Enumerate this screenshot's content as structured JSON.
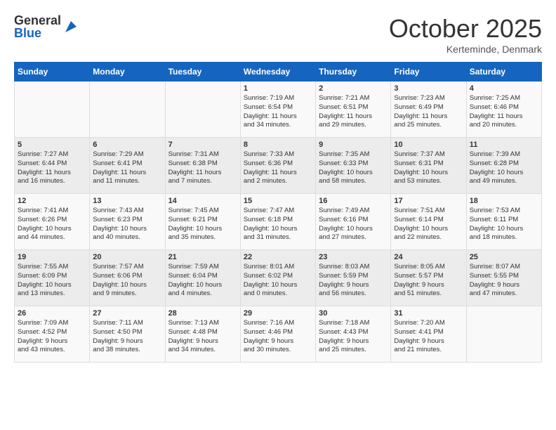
{
  "header": {
    "logo_general": "General",
    "logo_blue": "Blue",
    "month": "October 2025",
    "location": "Kerteminde, Denmark"
  },
  "days_of_week": [
    "Sunday",
    "Monday",
    "Tuesday",
    "Wednesday",
    "Thursday",
    "Friday",
    "Saturday"
  ],
  "weeks": [
    [
      {
        "day": "",
        "info": ""
      },
      {
        "day": "",
        "info": ""
      },
      {
        "day": "",
        "info": ""
      },
      {
        "day": "1",
        "info": "Sunrise: 7:19 AM\nSunset: 6:54 PM\nDaylight: 11 hours\nand 34 minutes."
      },
      {
        "day": "2",
        "info": "Sunrise: 7:21 AM\nSunset: 6:51 PM\nDaylight: 11 hours\nand 29 minutes."
      },
      {
        "day": "3",
        "info": "Sunrise: 7:23 AM\nSunset: 6:49 PM\nDaylight: 11 hours\nand 25 minutes."
      },
      {
        "day": "4",
        "info": "Sunrise: 7:25 AM\nSunset: 6:46 PM\nDaylight: 11 hours\nand 20 minutes."
      }
    ],
    [
      {
        "day": "5",
        "info": "Sunrise: 7:27 AM\nSunset: 6:44 PM\nDaylight: 11 hours\nand 16 minutes."
      },
      {
        "day": "6",
        "info": "Sunrise: 7:29 AM\nSunset: 6:41 PM\nDaylight: 11 hours\nand 11 minutes."
      },
      {
        "day": "7",
        "info": "Sunrise: 7:31 AM\nSunset: 6:38 PM\nDaylight: 11 hours\nand 7 minutes."
      },
      {
        "day": "8",
        "info": "Sunrise: 7:33 AM\nSunset: 6:36 PM\nDaylight: 11 hours\nand 2 minutes."
      },
      {
        "day": "9",
        "info": "Sunrise: 7:35 AM\nSunset: 6:33 PM\nDaylight: 10 hours\nand 58 minutes."
      },
      {
        "day": "10",
        "info": "Sunrise: 7:37 AM\nSunset: 6:31 PM\nDaylight: 10 hours\nand 53 minutes."
      },
      {
        "day": "11",
        "info": "Sunrise: 7:39 AM\nSunset: 6:28 PM\nDaylight: 10 hours\nand 49 minutes."
      }
    ],
    [
      {
        "day": "12",
        "info": "Sunrise: 7:41 AM\nSunset: 6:26 PM\nDaylight: 10 hours\nand 44 minutes."
      },
      {
        "day": "13",
        "info": "Sunrise: 7:43 AM\nSunset: 6:23 PM\nDaylight: 10 hours\nand 40 minutes."
      },
      {
        "day": "14",
        "info": "Sunrise: 7:45 AM\nSunset: 6:21 PM\nDaylight: 10 hours\nand 35 minutes."
      },
      {
        "day": "15",
        "info": "Sunrise: 7:47 AM\nSunset: 6:18 PM\nDaylight: 10 hours\nand 31 minutes."
      },
      {
        "day": "16",
        "info": "Sunrise: 7:49 AM\nSunset: 6:16 PM\nDaylight: 10 hours\nand 27 minutes."
      },
      {
        "day": "17",
        "info": "Sunrise: 7:51 AM\nSunset: 6:14 PM\nDaylight: 10 hours\nand 22 minutes."
      },
      {
        "day": "18",
        "info": "Sunrise: 7:53 AM\nSunset: 6:11 PM\nDaylight: 10 hours\nand 18 minutes."
      }
    ],
    [
      {
        "day": "19",
        "info": "Sunrise: 7:55 AM\nSunset: 6:09 PM\nDaylight: 10 hours\nand 13 minutes."
      },
      {
        "day": "20",
        "info": "Sunrise: 7:57 AM\nSunset: 6:06 PM\nDaylight: 10 hours\nand 9 minutes."
      },
      {
        "day": "21",
        "info": "Sunrise: 7:59 AM\nSunset: 6:04 PM\nDaylight: 10 hours\nand 4 minutes."
      },
      {
        "day": "22",
        "info": "Sunrise: 8:01 AM\nSunset: 6:02 PM\nDaylight: 10 hours\nand 0 minutes."
      },
      {
        "day": "23",
        "info": "Sunrise: 8:03 AM\nSunset: 5:59 PM\nDaylight: 9 hours\nand 56 minutes."
      },
      {
        "day": "24",
        "info": "Sunrise: 8:05 AM\nSunset: 5:57 PM\nDaylight: 9 hours\nand 51 minutes."
      },
      {
        "day": "25",
        "info": "Sunrise: 8:07 AM\nSunset: 5:55 PM\nDaylight: 9 hours\nand 47 minutes."
      }
    ],
    [
      {
        "day": "26",
        "info": "Sunrise: 7:09 AM\nSunset: 4:52 PM\nDaylight: 9 hours\nand 43 minutes."
      },
      {
        "day": "27",
        "info": "Sunrise: 7:11 AM\nSunset: 4:50 PM\nDaylight: 9 hours\nand 38 minutes."
      },
      {
        "day": "28",
        "info": "Sunrise: 7:13 AM\nSunset: 4:48 PM\nDaylight: 9 hours\nand 34 minutes."
      },
      {
        "day": "29",
        "info": "Sunrise: 7:16 AM\nSunset: 4:46 PM\nDaylight: 9 hours\nand 30 minutes."
      },
      {
        "day": "30",
        "info": "Sunrise: 7:18 AM\nSunset: 4:43 PM\nDaylight: 9 hours\nand 25 minutes."
      },
      {
        "day": "31",
        "info": "Sunrise: 7:20 AM\nSunset: 4:41 PM\nDaylight: 9 hours\nand 21 minutes."
      },
      {
        "day": "",
        "info": ""
      }
    ]
  ]
}
